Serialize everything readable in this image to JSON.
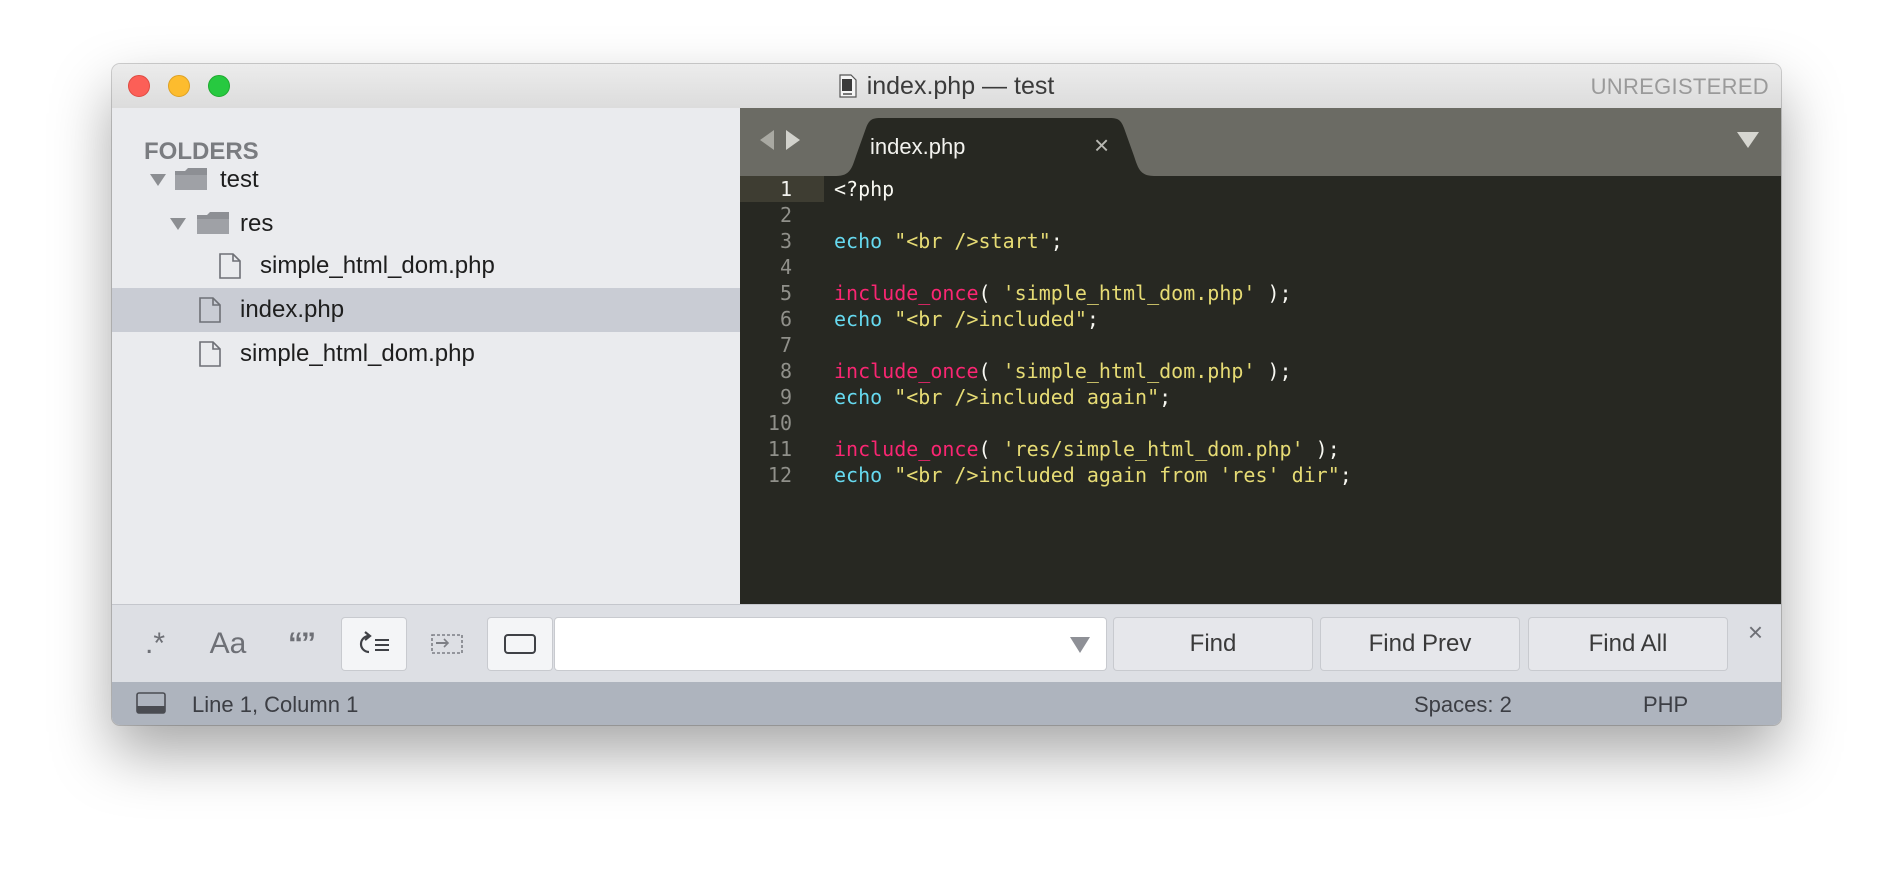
{
  "window": {
    "title": "index.php — test",
    "unregistered": "UNREGISTERED"
  },
  "sidebar": {
    "header": "FOLDERS",
    "tree": [
      {
        "label": "test",
        "type": "folder",
        "depth": 0,
        "expanded": true,
        "selected": false
      },
      {
        "label": "res",
        "type": "folder",
        "depth": 1,
        "expanded": true,
        "selected": false
      },
      {
        "label": "simple_html_dom.php",
        "type": "file",
        "depth": 2,
        "selected": false
      },
      {
        "label": "index.php",
        "type": "file",
        "depth": 1,
        "selected": true
      },
      {
        "label": "simple_html_dom.php",
        "type": "file",
        "depth": 1,
        "selected": false
      }
    ]
  },
  "editor": {
    "tab": {
      "label": "index.php",
      "close_glyph": "×"
    },
    "active_line": 1,
    "lines": [
      {
        "num": "1",
        "tokens": [
          {
            "t": "<?php",
            "c": "plain"
          }
        ]
      },
      {
        "num": "2",
        "tokens": []
      },
      {
        "num": "3",
        "tokens": [
          {
            "t": "echo",
            "c": "kw"
          },
          {
            "t": " ",
            "c": "plain"
          },
          {
            "t": "\"<br />start\"",
            "c": "str"
          },
          {
            "t": ";",
            "c": "plain"
          }
        ]
      },
      {
        "num": "4",
        "tokens": []
      },
      {
        "num": "5",
        "tokens": [
          {
            "t": "include_once",
            "c": "fn"
          },
          {
            "t": "( ",
            "c": "plain"
          },
          {
            "t": "'simple_html_dom.php'",
            "c": "str"
          },
          {
            "t": " );",
            "c": "plain"
          }
        ]
      },
      {
        "num": "6",
        "tokens": [
          {
            "t": "echo",
            "c": "kw"
          },
          {
            "t": " ",
            "c": "plain"
          },
          {
            "t": "\"<br />included\"",
            "c": "str"
          },
          {
            "t": ";",
            "c": "plain"
          }
        ]
      },
      {
        "num": "7",
        "tokens": []
      },
      {
        "num": "8",
        "tokens": [
          {
            "t": "include_once",
            "c": "fn"
          },
          {
            "t": "( ",
            "c": "plain"
          },
          {
            "t": "'simple_html_dom.php'",
            "c": "str"
          },
          {
            "t": " );",
            "c": "plain"
          }
        ]
      },
      {
        "num": "9",
        "tokens": [
          {
            "t": "echo",
            "c": "kw"
          },
          {
            "t": " ",
            "c": "plain"
          },
          {
            "t": "\"<br />included again\"",
            "c": "str"
          },
          {
            "t": ";",
            "c": "plain"
          }
        ]
      },
      {
        "num": "10",
        "tokens": []
      },
      {
        "num": "11",
        "tokens": [
          {
            "t": "include_once",
            "c": "fn"
          },
          {
            "t": "( ",
            "c": "plain"
          },
          {
            "t": "'res/simple_html_dom.php'",
            "c": "str"
          },
          {
            "t": " );",
            "c": "plain"
          }
        ]
      },
      {
        "num": "12",
        "tokens": [
          {
            "t": "echo",
            "c": "kw"
          },
          {
            "t": " ",
            "c": "plain"
          },
          {
            "t": "\"<br />included again from 'res' dir\"",
            "c": "str"
          },
          {
            "t": ";",
            "c": "plain"
          }
        ]
      }
    ]
  },
  "findbar": {
    "options": [
      {
        "label": ".*",
        "name": "regex-toggle",
        "on": false
      },
      {
        "label": "Aa",
        "name": "case-sensitive-toggle",
        "on": false
      },
      {
        "label": "“”",
        "name": "whole-word-toggle",
        "on": false
      },
      {
        "label": "",
        "name": "wrap-toggle",
        "on": true
      },
      {
        "label": "",
        "name": "in-selection-toggle",
        "on": false
      },
      {
        "label": "",
        "name": "highlight-matches-toggle",
        "on": true
      }
    ],
    "input_value": "",
    "find_label": "Find",
    "find_prev_label": "Find Prev",
    "find_all_label": "Find All",
    "close_glyph": "×"
  },
  "statusbar": {
    "position": "Line 1, Column 1",
    "spaces": "Spaces: 2",
    "syntax": "PHP"
  },
  "colors": {
    "keyword": "#66d9ef",
    "function": "#f92672",
    "string": "#e6db74",
    "plain": "#f8f8f2",
    "editor_bg": "#272822"
  }
}
